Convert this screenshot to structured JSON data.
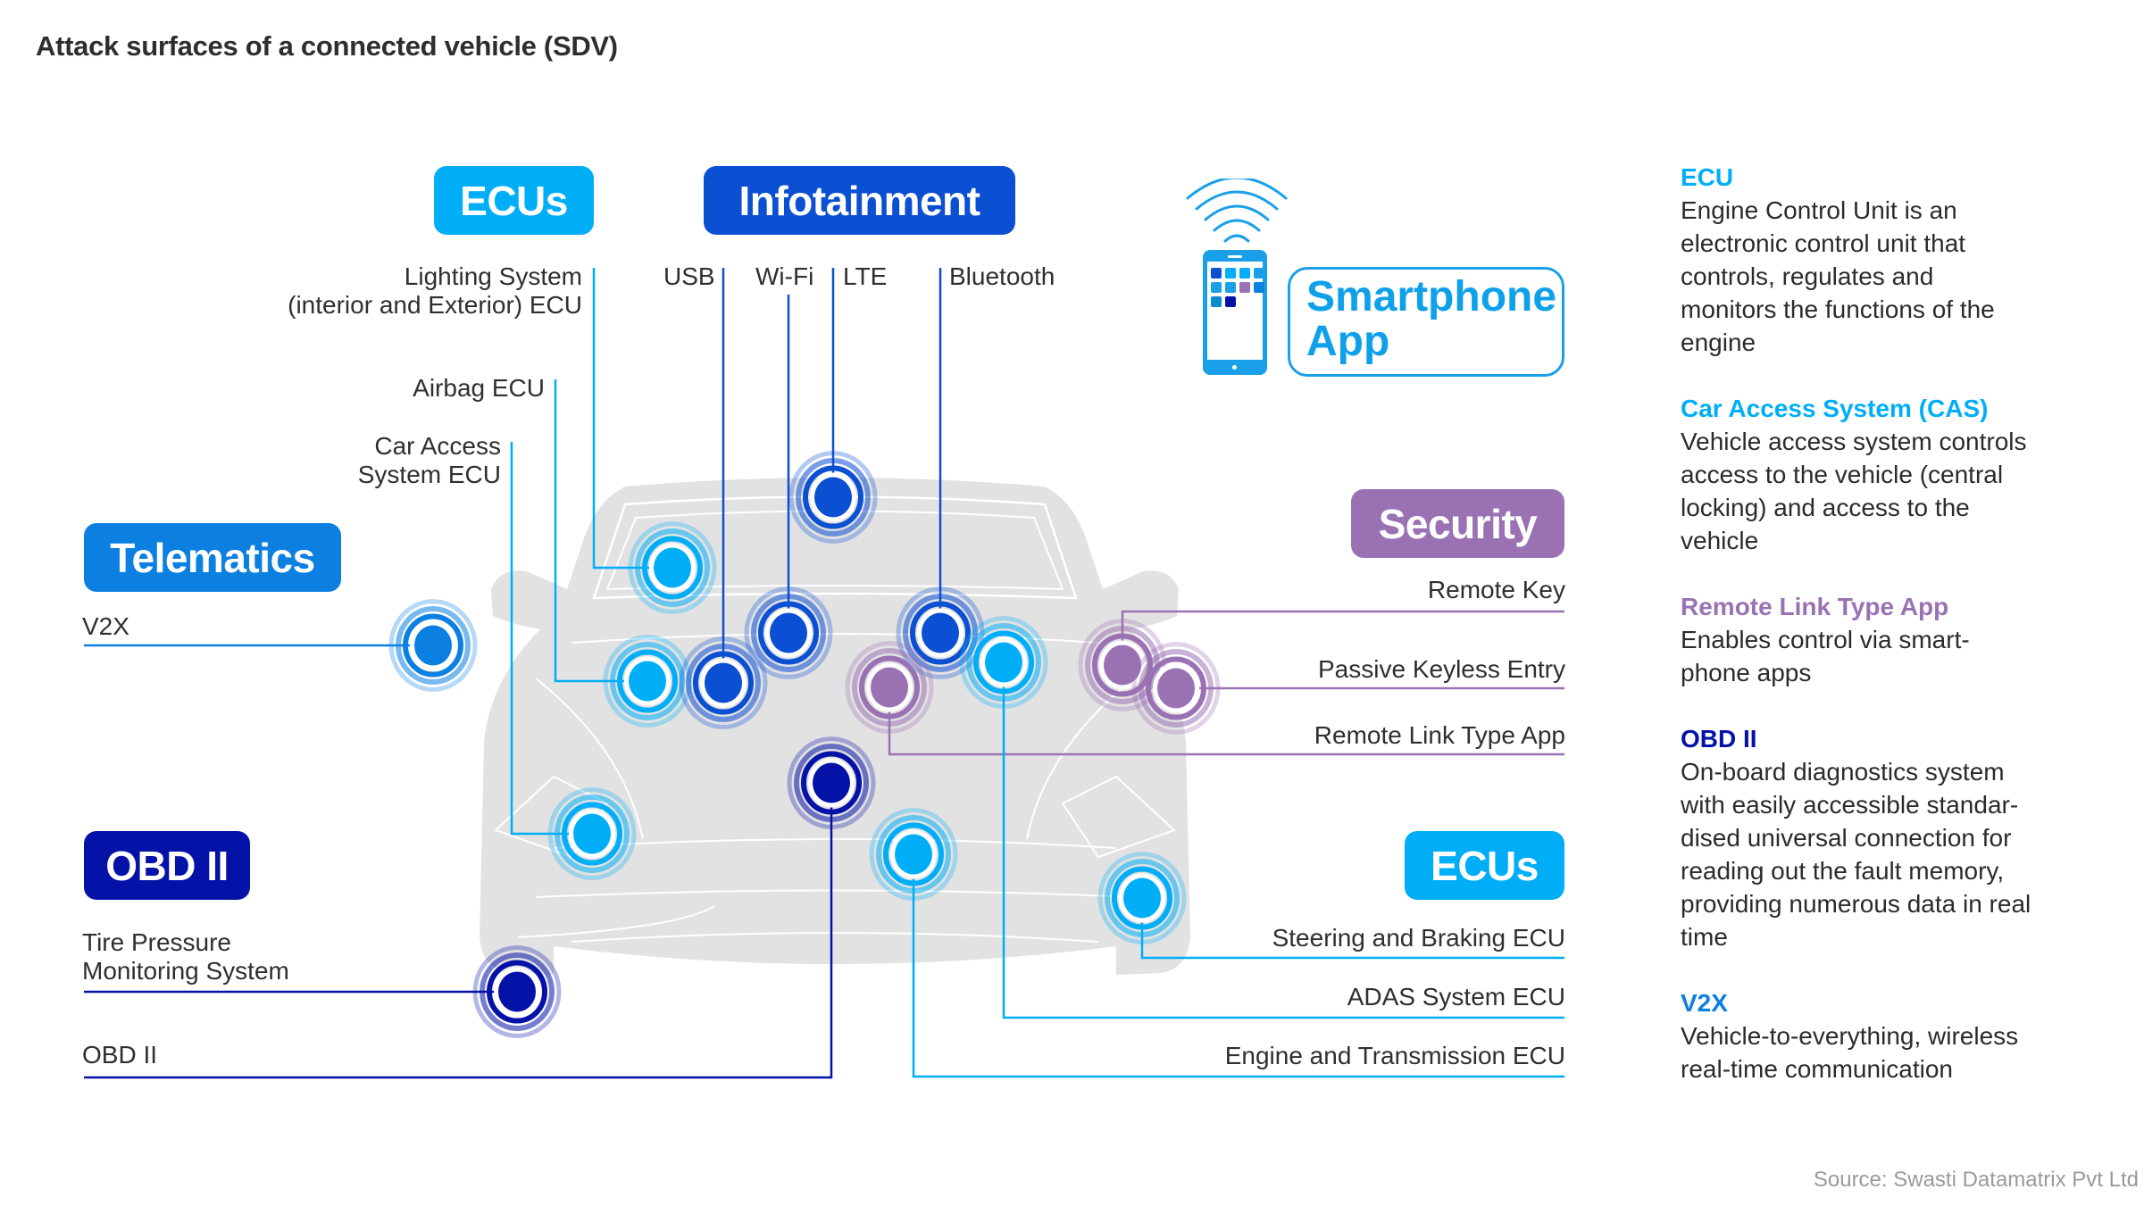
{
  "title": "Attack surfaces of a connected vehicle (SDV)",
  "colors": {
    "ecu": "#00aef8",
    "infotainment": "#0b4fd3",
    "telematics": "#0b80e0",
    "obd": "#0512a8",
    "security": "#9a72b4",
    "smartphone": "#1aa0e8",
    "car_body": "#e2e2e2"
  },
  "categories": {
    "ecus_top": "ECUs",
    "infotainment": "Infotainment",
    "telematics": "Telematics",
    "obd": "OBD II",
    "security": "Security",
    "ecus_right": "ECUs",
    "smartphone": "Smartphone App"
  },
  "smartphone": {
    "line1": "Smartphone",
    "line2": "App",
    "app_icon_colors": [
      "#0b4fd3",
      "#00aef8",
      "#00aef8",
      "#1aa0e8",
      "#1aa0e8",
      "#1aa0e8",
      "#9a72b4",
      "#0b80e0",
      "#0b8ad0",
      "#0512a8"
    ]
  },
  "attack_points": [
    {
      "id": "lighting",
      "label_lines": [
        "Lighting System",
        "(interior and Exterior) ECU"
      ],
      "group": "ecu"
    },
    {
      "id": "airbag",
      "label_lines": [
        "Airbag ECU"
      ],
      "group": "ecu"
    },
    {
      "id": "car_access",
      "label_lines": [
        "Car Access",
        "System ECU"
      ],
      "group": "ecu"
    },
    {
      "id": "usb",
      "label_lines": [
        "USB"
      ],
      "group": "infotainment"
    },
    {
      "id": "wifi",
      "label_lines": [
        "Wi-Fi"
      ],
      "group": "infotainment"
    },
    {
      "id": "lte",
      "label_lines": [
        "LTE"
      ],
      "group": "infotainment"
    },
    {
      "id": "bluetooth",
      "label_lines": [
        "Bluetooth"
      ],
      "group": "infotainment"
    },
    {
      "id": "v2x",
      "label_lines": [
        "V2X"
      ],
      "group": "telematics"
    },
    {
      "id": "tpms",
      "label_lines": [
        "Tire Pressure",
        "Monitoring System"
      ],
      "group": "obd"
    },
    {
      "id": "obd",
      "label_lines": [
        "OBD II"
      ],
      "group": "obd"
    },
    {
      "id": "remote_key",
      "label_lines": [
        "Remote Key"
      ],
      "group": "security"
    },
    {
      "id": "pke",
      "label_lines": [
        "Passive Keyless Entry"
      ],
      "group": "security"
    },
    {
      "id": "rlta",
      "label_lines": [
        "Remote Link Type App"
      ],
      "group": "security"
    },
    {
      "id": "steering",
      "label_lines": [
        "Steering and Braking ECU"
      ],
      "group": "ecu"
    },
    {
      "id": "adas",
      "label_lines": [
        "ADAS System ECU"
      ],
      "group": "ecu"
    },
    {
      "id": "engine",
      "label_lines": [
        "Engine and Transmission ECU"
      ],
      "group": "ecu"
    }
  ],
  "legend": [
    {
      "heading": "ECU",
      "color": "#00aef8",
      "text": "Engine Control Unit is an electronic control unit that controls, regulates and monitors the functions of the engine"
    },
    {
      "heading": "Car Access System (CAS)",
      "color": "#00aef8",
      "text": "Vehicle access system controls access to the vehicle (central locking) and access to the vehicle"
    },
    {
      "heading": "Remote Link Type App",
      "color": "#9a72b4",
      "text": "Enables control via smart-phone apps"
    },
    {
      "heading": "OBD II",
      "color": "#0512a8",
      "text": "On-board diagnostics system with easily accessible standar-dised universal connection for reading out the fault memory, providing numerous data in real time"
    },
    {
      "heading": "V2X",
      "color": "#0b80e0",
      "text": "Vehicle-to-everything, wireless real-time communication"
    }
  ],
  "source": "Source: Swasti Datamatrix Pvt Ltd"
}
